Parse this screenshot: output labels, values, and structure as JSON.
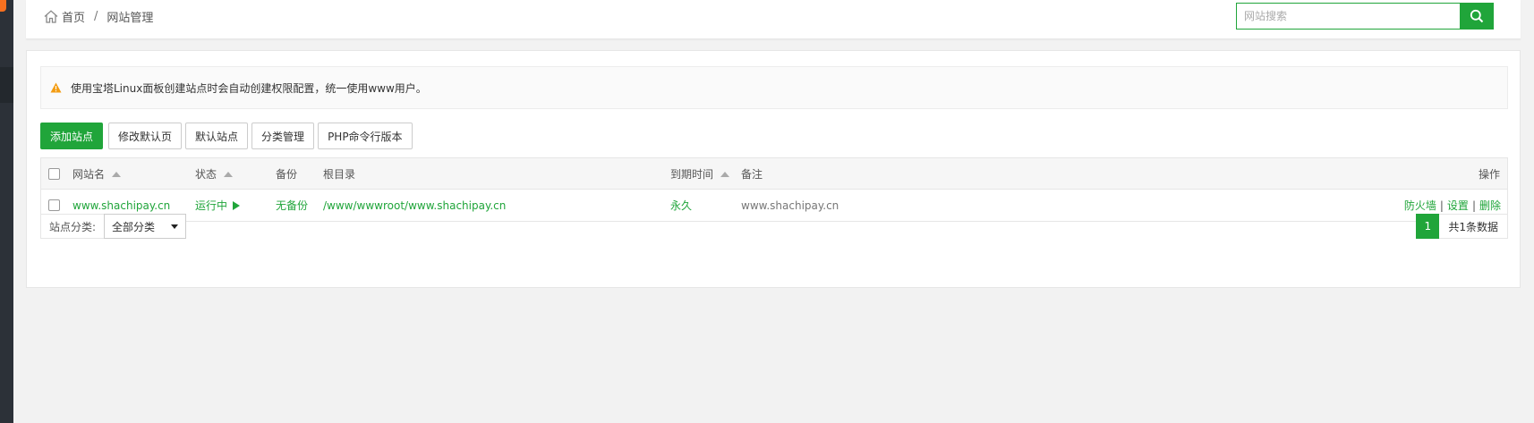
{
  "breadcrumb": {
    "home": "首页",
    "separator": "/",
    "current": "网站管理"
  },
  "search": {
    "placeholder": "网站搜索",
    "value": ""
  },
  "alert": {
    "text": "使用宝塔Linux面板创建站点时会自动创建权限配置，统一使用www用户。"
  },
  "toolbar": {
    "add_site": "添加站点",
    "modify_default_page": "修改默认页",
    "default_site": "默认站点",
    "category_manage": "分类管理",
    "php_cli_version": "PHP命令行版本"
  },
  "table": {
    "headers": {
      "name": "网站名",
      "status": "状态",
      "backup": "备份",
      "root": "根目录",
      "expire": "到期时间",
      "note": "备注",
      "ops": "操作"
    },
    "rows": [
      {
        "name": "www.shachipay.cn",
        "status": "运行中",
        "backup": "无备份",
        "root": "/www/wwwroot/www.shachipay.cn",
        "expire": "永久",
        "note": "www.shachipay.cn",
        "ops": {
          "firewall": "防火墙",
          "settings": "设置",
          "delete": "删除",
          "divider": "|"
        }
      }
    ]
  },
  "footer": {
    "category_label": "站点分类:",
    "category_selected": "全部分类",
    "current_page": "1",
    "total_text": "共1条数据"
  },
  "colors": {
    "accent": "#20a53a",
    "warning": "#f39c12",
    "sidebar": "#2c3138"
  }
}
